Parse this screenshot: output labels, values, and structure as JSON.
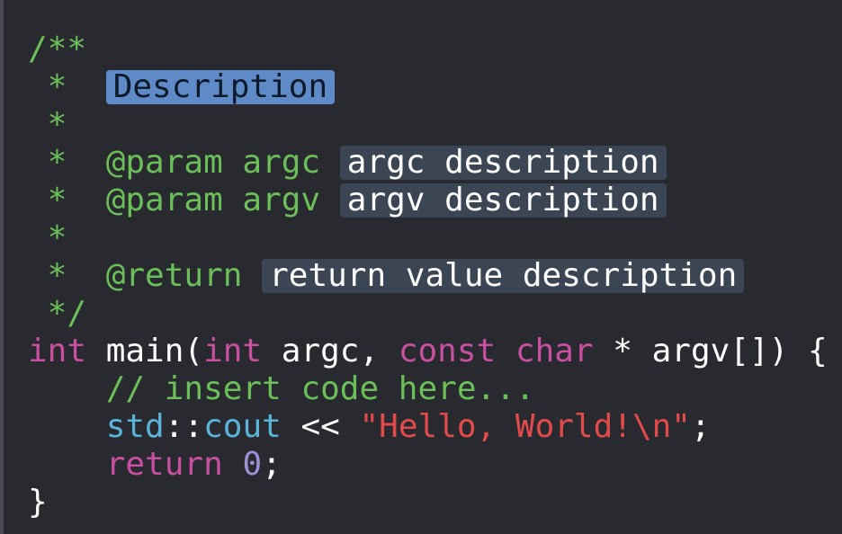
{
  "code": {
    "lines": [
      {
        "tokens": [
          {
            "t": "cm",
            "v": "/**"
          }
        ]
      },
      {
        "tokens": [
          {
            "t": "cm",
            "v": " *  "
          },
          {
            "t": "ph-sel",
            "v": "Description"
          }
        ]
      },
      {
        "tokens": [
          {
            "t": "cm",
            "v": " *"
          }
        ]
      },
      {
        "tokens": [
          {
            "t": "cm",
            "v": " *  @param argc "
          },
          {
            "t": "ph",
            "v": "argc description"
          }
        ]
      },
      {
        "tokens": [
          {
            "t": "cm",
            "v": " *  @param argv "
          },
          {
            "t": "ph",
            "v": "argv description"
          }
        ]
      },
      {
        "tokens": [
          {
            "t": "cm",
            "v": " *"
          }
        ]
      },
      {
        "tokens": [
          {
            "t": "cm",
            "v": " *  @return "
          },
          {
            "t": "ph",
            "v": "return value description"
          }
        ]
      },
      {
        "tokens": [
          {
            "t": "cm",
            "v": " */"
          }
        ]
      },
      {
        "tokens": [
          {
            "t": "kw",
            "v": "int"
          },
          {
            "t": "pl",
            "v": " main("
          },
          {
            "t": "kw",
            "v": "int"
          },
          {
            "t": "pl",
            "v": " argc, "
          },
          {
            "t": "kw",
            "v": "const"
          },
          {
            "t": "pl",
            "v": " "
          },
          {
            "t": "kw",
            "v": "char"
          },
          {
            "t": "pl",
            "v": " * argv[]) {"
          }
        ]
      },
      {
        "tokens": [
          {
            "t": "pl",
            "v": "    "
          },
          {
            "t": "cm",
            "v": "// insert code here..."
          }
        ]
      },
      {
        "tokens": [
          {
            "t": "pl",
            "v": "    "
          },
          {
            "t": "ty",
            "v": "std"
          },
          {
            "t": "pl",
            "v": "::"
          },
          {
            "t": "ty",
            "v": "cout"
          },
          {
            "t": "pl",
            "v": " << "
          },
          {
            "t": "st",
            "v": "\"Hello, World!\\n\""
          },
          {
            "t": "pl",
            "v": ";"
          }
        ]
      },
      {
        "tokens": [
          {
            "t": "pl",
            "v": "    "
          },
          {
            "t": "kw",
            "v": "return"
          },
          {
            "t": "pl",
            "v": " "
          },
          {
            "t": "nu",
            "v": "0"
          },
          {
            "t": "pl",
            "v": ";"
          }
        ]
      },
      {
        "tokens": [
          {
            "t": "pl",
            "v": "}"
          }
        ]
      }
    ]
  },
  "colors": {
    "background": "#292a30",
    "comment": "#6bbf59",
    "keyword": "#c94fa0",
    "type": "#5bb3d9",
    "string": "#e34b4b",
    "number": "#9e8fd6",
    "placeholder": "#3c4554",
    "placeholder_selected": "#5f8ac8"
  }
}
